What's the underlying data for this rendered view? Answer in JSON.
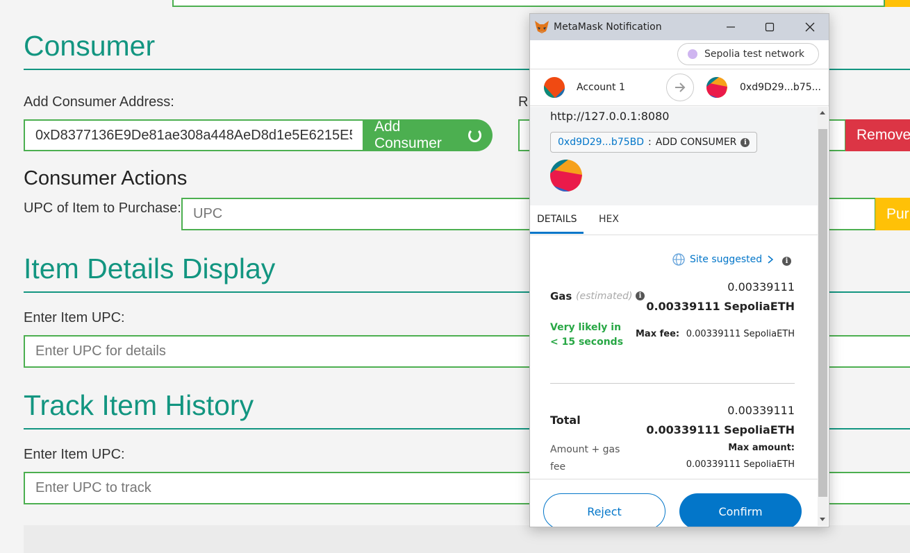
{
  "dapp": {
    "consumer_heading": "Consumer",
    "add_consumer_label": "Add Consumer Address:",
    "add_consumer_value": "0xD8377136E9De81ae308a448AeD8d1e5E6215E5",
    "add_consumer_button": "Add Consumer",
    "remove_label_fragment": "R",
    "remove_button": "Remove",
    "consumer_actions_heading": "Consumer Actions",
    "upc_purchase_label": "UPC of Item to Purchase:",
    "upc_purchase_placeholder": "UPC",
    "purchase_button_fragment": "Pur",
    "item_details_heading": "Item Details Display",
    "item_details_label": "Enter Item UPC:",
    "item_details_placeholder": "Enter UPC for details",
    "track_heading": "Track Item History",
    "track_label": "Enter Item UPC:",
    "track_placeholder": "Enter UPC to track"
  },
  "metamask": {
    "window_title": "MetaMask Notification",
    "network": "Sepolia test network",
    "from_account": "Account 1",
    "to_account": "0xd9D29...b75...",
    "origin": "http://127.0.0.1:8080",
    "contract_addr": "0xd9D29...b75BD",
    "method_sep": ":",
    "method": "ADD CONSUMER",
    "tabs": [
      "DETAILS",
      "HEX"
    ],
    "site_suggested": "Site suggested",
    "gas_label": "Gas",
    "gas_estimated": "(estimated)",
    "gas_value": "0.00339111",
    "gas_value_eth": "0.00339111 SepoliaETH",
    "likely_time": "Very likely in < 15 seconds",
    "max_fee_label": "Max fee:",
    "max_fee_value": "0.00339111 SepoliaETH",
    "total_label": "Total",
    "total_value": "0.00339111",
    "total_value_eth": "0.00339111 SepoliaETH",
    "amount_gas_fee": "Amount + gas fee",
    "max_amount_label": "Max amount:",
    "max_amount_value": "0.00339111 SepoliaETH",
    "reject": "Reject",
    "confirm": "Confirm"
  },
  "colors": {
    "teal": "#129580",
    "green": "#4caf50",
    "red": "#dc3545",
    "yellow": "#ffc107",
    "mm_blue": "#0376c9",
    "success": "#28a745"
  }
}
